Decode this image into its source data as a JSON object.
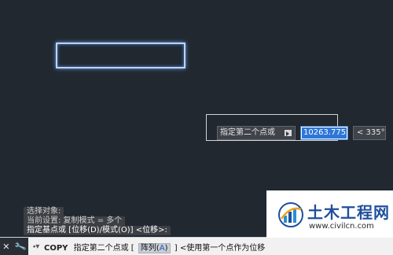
{
  "history": {
    "line1": "选择对象:",
    "line2": "当前设置:  复制模式 = 多个",
    "line3": "指定基点或 [位移(D)/模式(O)] <位移>:"
  },
  "tooltip": {
    "prompt": "指定第二个点或",
    "value": "10263.7753",
    "angle": "< 335°"
  },
  "command_line": {
    "command": "COPY",
    "prompt": "指定第二个点或",
    "bracket_open": "[",
    "option_label": "阵列(",
    "option_key": "A",
    "option_close": ")",
    "bracket_close": "]",
    "tail": "<使用第一个点作为位移"
  },
  "watermark": {
    "title": "土木工程网",
    "url": "www.civilcn.com"
  },
  "colors": {
    "canvas": "#212830",
    "selection_glow": "#6b9fe8",
    "input_highlight": "#2f76d6"
  }
}
